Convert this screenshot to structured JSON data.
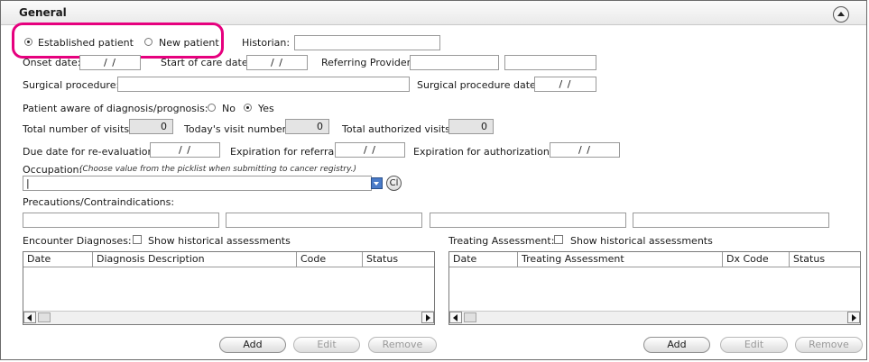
{
  "header": {
    "title": "General"
  },
  "patient_type": {
    "established_label": "Established patient",
    "new_label": "New patient",
    "selected": "established"
  },
  "historian": {
    "label": "Historian:",
    "value": ""
  },
  "onset_date": {
    "label": "Onset date:",
    "value": "/ /"
  },
  "start_of_care": {
    "label": "Start of care date:",
    "value": "/ /"
  },
  "referring_provider": {
    "label": "Referring Provider:",
    "value1": "",
    "value2": ""
  },
  "surgical_procedure": {
    "label": "Surgical procedure:",
    "value": ""
  },
  "surgical_procedure_date": {
    "label": "Surgical procedure date:",
    "value": "/ /"
  },
  "aware": {
    "label": "Patient aware of diagnosis/prognosis:",
    "no_label": "No",
    "yes_label": "Yes",
    "selected": "yes"
  },
  "visits": {
    "total_label": "Total number of visits:",
    "total_value": "0",
    "today_label": "Today's visit number:",
    "today_value": "0",
    "authorized_label": "Total authorized visits:",
    "authorized_value": "0"
  },
  "dates": {
    "reeval_label": "Due date for re-evaluation:",
    "reeval_value": "/ /",
    "referral_label": "Expiration for referral:",
    "referral_value": "/ /",
    "auth_label": "Expiration for authorization:",
    "auth_value": "/ /"
  },
  "occupation": {
    "label": "Occupation:",
    "hint": "(Choose value from the picklist when submitting to cancer registry.)",
    "value": "|",
    "clear_label": "Cl"
  },
  "precautions": {
    "label": "Precautions/Contraindications:"
  },
  "encounter": {
    "label": "Encounter Diagnoses:",
    "show_historical": "Show historical assessments",
    "columns": [
      "Date",
      "Diagnosis Description",
      "Code",
      "Status"
    ],
    "add": "Add",
    "edit": "Edit",
    "remove": "Remove"
  },
  "treating": {
    "label": "Treating Assessment:",
    "show_historical": "Show historical assessments",
    "columns": [
      "Date",
      "Treating Assessment",
      "Dx Code",
      "Status"
    ],
    "add": "Add",
    "edit": "Edit",
    "remove": "Remove"
  },
  "colors": {
    "highlight": "#e6007e",
    "dropdown": "#4a7bc8"
  }
}
